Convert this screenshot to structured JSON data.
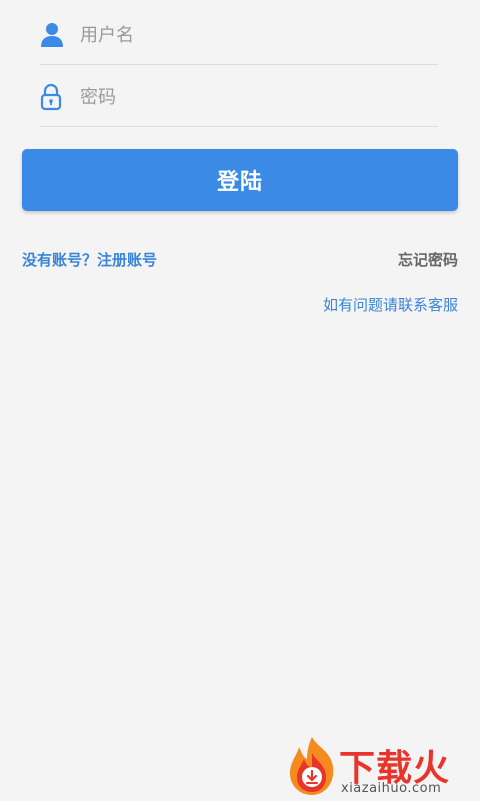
{
  "form": {
    "username_placeholder": "用户名",
    "username_icon": "user-icon",
    "password_placeholder": "密码",
    "password_icon": "lock-icon"
  },
  "login_button_label": "登陆",
  "links": {
    "register": "没有账号？注册账号",
    "forgot_password": "忘记密码",
    "contact": "如有问题请联系客服"
  },
  "watermark": {
    "title": "下载火",
    "domain": "xiazaihuo.com"
  },
  "colors": {
    "accent": "#3a8ae6",
    "link_blue": "#3a85d8",
    "muted_link": "#666666",
    "background": "#f4f4f4",
    "icon_blue": "#3a8ae6",
    "watermark_red": "#e8342b"
  }
}
